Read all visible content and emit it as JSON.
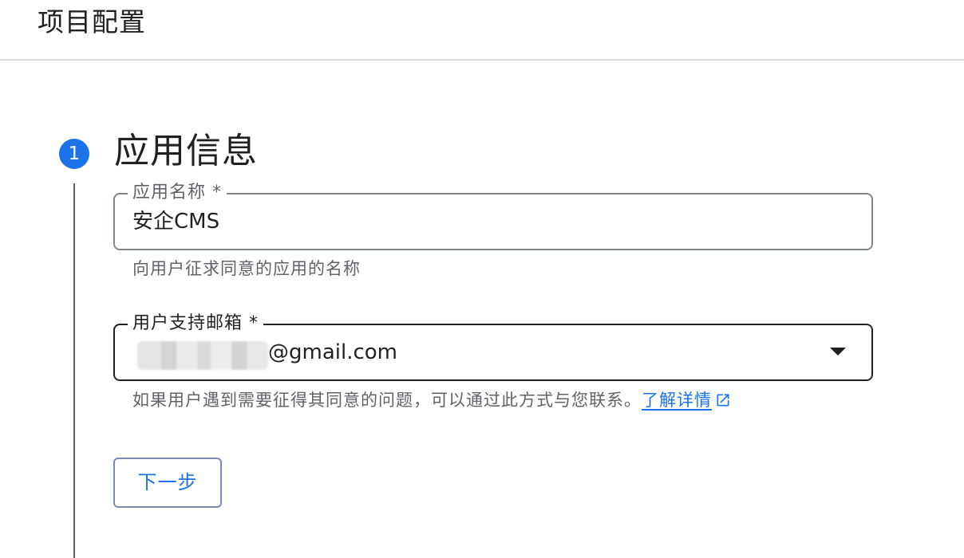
{
  "header": {
    "title": "项目配置"
  },
  "step": {
    "number": "1",
    "title": "应用信息"
  },
  "app_name_field": {
    "label": "应用名称 *",
    "value": "安企CMS",
    "helper": "向用户征求同意的应用的名称"
  },
  "email_field": {
    "label": "用户支持邮箱 *",
    "value_visible": "@gmail.com",
    "helper": "如果用户遇到需要征得其同意的问题，可以通过此方式与您联系。",
    "learn_more": "了解详情"
  },
  "next_button": {
    "label": "下一步"
  },
  "colors": {
    "accent": "#1a73e8",
    "text": "#202124",
    "secondary_text": "#5f6368",
    "divider": "#dadce0"
  },
  "icons": {
    "step_indicator": "step-number-circle",
    "dropdown": "caret-down-icon",
    "external_link": "external-link-icon"
  }
}
